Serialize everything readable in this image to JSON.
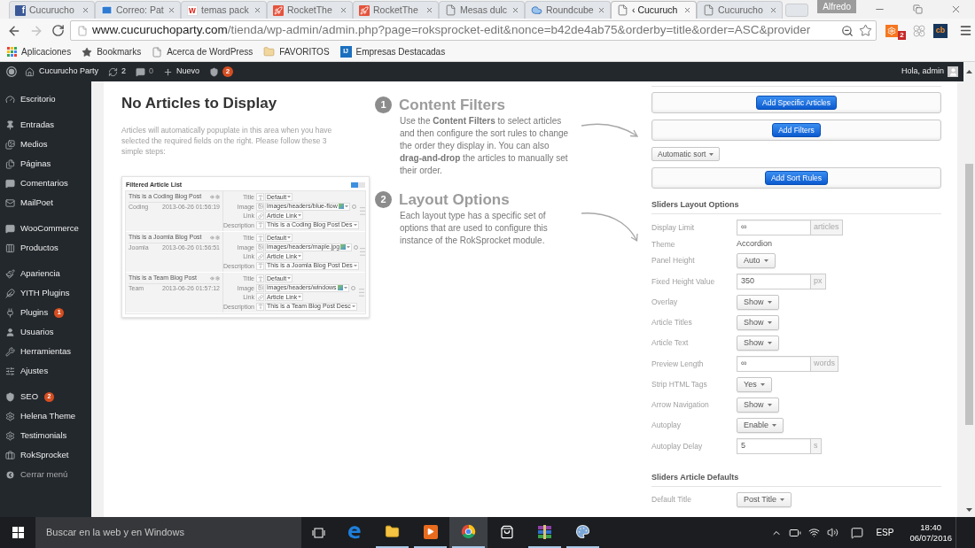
{
  "browser": {
    "tabs": [
      {
        "title": "Cucurucho",
        "kind": "f-tile",
        "glyph": "f",
        "selected": false
      },
      {
        "title": "Correo: Pat",
        "kind": "envelope",
        "selected": false
      },
      {
        "title": "temas pack",
        "kind": "w-tile",
        "glyph": "w",
        "selected": false
      },
      {
        "title": "RocketThe",
        "kind": "rocket",
        "selected": false
      },
      {
        "title": "RocketThe",
        "kind": "rocket",
        "selected": false
      },
      {
        "title": "Mesas dulc",
        "kind": "page",
        "selected": false
      },
      {
        "title": "Roundcube",
        "kind": "cloud",
        "selected": false
      },
      {
        "title": "‹ Cucuruch",
        "kind": "page",
        "selected": true
      },
      {
        "title": "Cucurucho",
        "kind": "page",
        "selected": false
      }
    ],
    "profile": "Alfredo",
    "url": {
      "host": "www.cucuruchoparty.com",
      "path": "/tienda/wp-admin/admin.php?page=roksprocket-edit&nonce=b42de4ab75&orderby=title&order=ASC&provider"
    },
    "extensions": [
      {
        "kind": "sprocket",
        "badge": "2"
      },
      {
        "kind": "flower"
      },
      {
        "kind": "tile",
        "glyph": "cb"
      }
    ],
    "bookmarks": [
      {
        "label": "Aplicaciones",
        "kind": "apps"
      },
      {
        "label": "Bookmarks",
        "kind": "star"
      },
      {
        "label": "Acerca de WordPress",
        "kind": "page"
      },
      {
        "label": "FAVORITOS",
        "kind": "folder"
      },
      {
        "label": "Empresas Destacadas",
        "kind": "tile",
        "glyph": "IJ"
      }
    ]
  },
  "admin_bar": {
    "site": "Cucurucho Party",
    "updates": "2",
    "comments": "0",
    "new": "Nuevo",
    "seo_badge": "2",
    "greeting": "Hola, admin"
  },
  "sidebar": {
    "groups": [
      {
        "items": [
          {
            "label": "Escritorio",
            "kind": "gauge"
          }
        ]
      },
      {
        "items": [
          {
            "label": "Entradas",
            "kind": "pin"
          },
          {
            "label": "Medios",
            "kind": "media"
          },
          {
            "label": "Páginas",
            "kind": "pages"
          },
          {
            "label": "Comentarios",
            "kind": "comment"
          },
          {
            "label": "MailPoet",
            "kind": "mail"
          }
        ]
      },
      {
        "items": [
          {
            "label": "WooCommerce",
            "kind": "bubble"
          },
          {
            "label": "Productos",
            "kind": "columns"
          }
        ]
      },
      {
        "items": [
          {
            "label": "Apariencia",
            "kind": "brush"
          },
          {
            "label": "YITH Plugins",
            "kind": "feather"
          },
          {
            "label": "Plugins",
            "kind": "plug",
            "badge": "1"
          },
          {
            "label": "Usuarios",
            "kind": "user"
          },
          {
            "label": "Herramientas",
            "kind": "wrench"
          },
          {
            "label": "Ajustes",
            "kind": "sliders"
          }
        ]
      },
      {
        "items": [
          {
            "label": "SEO",
            "kind": "shield",
            "badge": "2"
          },
          {
            "label": "Helena Theme",
            "kind": "gear"
          },
          {
            "label": "Testimonials",
            "kind": "gear"
          },
          {
            "label": "RokSprocket",
            "kind": "briefcase"
          }
        ]
      }
    ],
    "collapse": "Cerrar menú"
  },
  "main": {
    "empty_title": "No Articles to Display",
    "empty_text": "Articles will automatically popuplate in this area when you have selected the required fields on the right. Please follow these 3 simple steps:",
    "example": {
      "title": "Filtered Article List",
      "articles": [
        {
          "title": "This is a Coding Blog Post",
          "category": "Coding",
          "date": "2013-06-26 01:56:19",
          "fields": [
            {
              "label": "Title",
              "kind": "text",
              "value": "Default"
            },
            {
              "label": "Image",
              "kind": "image",
              "value": "images/headers/blue-flow"
            },
            {
              "label": "Link",
              "kind": "link",
              "value": "Article Link"
            },
            {
              "label": "Description",
              "kind": "text",
              "value": "This is a Coding Blog Post Des"
            }
          ]
        },
        {
          "title": "This is a Joomla Blog Post",
          "category": "Joomla",
          "date": "2013-06-26 01:56:51",
          "fields": [
            {
              "label": "Title",
              "kind": "text",
              "value": "Default"
            },
            {
              "label": "Image",
              "kind": "image",
              "value": "images/headers/maple.jpg"
            },
            {
              "label": "Link",
              "kind": "link",
              "value": "Article Link"
            },
            {
              "label": "Description",
              "kind": "text",
              "value": "This is a Joomla Blog Post Des"
            }
          ]
        },
        {
          "title": "This is a Team Blog Post",
          "category": "Team",
          "date": "2013-06-26 01:57:12",
          "fields": [
            {
              "label": "Title",
              "kind": "text",
              "value": "Default"
            },
            {
              "label": "Image",
              "kind": "image",
              "value": "images/headers/windows"
            },
            {
              "label": "Link",
              "kind": "link",
              "value": "Article Link"
            },
            {
              "label": "Description",
              "kind": "text",
              "value": "This is a Team Blog Post Desc"
            }
          ]
        }
      ]
    },
    "steps": [
      {
        "number": "1",
        "title": "Content Filters",
        "text": "Use the **Content Filters** to select articles and then configure the sort rules to change the order they display in. You can also **drag-and-drop** the articles to manually set their order."
      },
      {
        "number": "2",
        "title": "Layout Options",
        "text": "Each layout type has a specific set of options that are used to configure this instance of the RokSprocket module."
      }
    ]
  },
  "options": {
    "actions": [
      {
        "kind": "button-box",
        "label": "Add Specific Articles"
      },
      {
        "kind": "button-box",
        "label": "Add Filters"
      },
      {
        "kind": "dropdown",
        "label": "Automatic sort"
      },
      {
        "kind": "button-box",
        "label": "Add Sort Rules"
      }
    ],
    "sections": [
      {
        "title": "Sliders Layout Options",
        "rows": [
          {
            "label": "Display Limit",
            "kind": "input",
            "value": "∞",
            "unit": "articles"
          },
          {
            "label": "Theme",
            "kind": "text",
            "value": "Accordion"
          },
          {
            "label": "Panel Height",
            "kind": "select",
            "value": "Auto"
          },
          {
            "label": "Fixed Height Value",
            "kind": "input",
            "value": "350",
            "unit": "px"
          },
          {
            "label": "Overlay",
            "kind": "select",
            "value": "Show"
          },
          {
            "label": "Article Titles",
            "kind": "select",
            "value": "Show"
          },
          {
            "label": "Article Text",
            "kind": "select",
            "value": "Show"
          },
          {
            "label": "Preview Length",
            "kind": "input",
            "value": "∞",
            "unit": "words"
          },
          {
            "label": "Strip HTML Tags",
            "kind": "select",
            "value": "Yes"
          },
          {
            "label": "Arrow Navigation",
            "kind": "select",
            "value": "Show"
          },
          {
            "label": "Autoplay",
            "kind": "select",
            "value": "Enable"
          },
          {
            "label": "Autoplay Delay",
            "kind": "input",
            "value": "5",
            "unit": "s"
          }
        ]
      },
      {
        "title": "Sliders Article Defaults",
        "rows": [
          {
            "label": "Default Title",
            "kind": "select",
            "value": "Post Title"
          }
        ]
      }
    ]
  },
  "taskbar": {
    "search_placeholder": "Buscar en la web y en Windows",
    "apps": [
      {
        "kind": "edge",
        "running": false,
        "selected": false
      },
      {
        "kind": "folder",
        "running": true,
        "selected": false
      },
      {
        "kind": "player",
        "running": true,
        "selected": false
      },
      {
        "kind": "chrome",
        "running": true,
        "selected": true
      },
      {
        "kind": "store",
        "running": false,
        "selected": false
      },
      {
        "kind": "books",
        "running": true,
        "selected": false
      },
      {
        "kind": "palette",
        "running": true,
        "selected": false
      }
    ],
    "language": "ESP",
    "time": "18:40",
    "date": "06/07/2016"
  }
}
